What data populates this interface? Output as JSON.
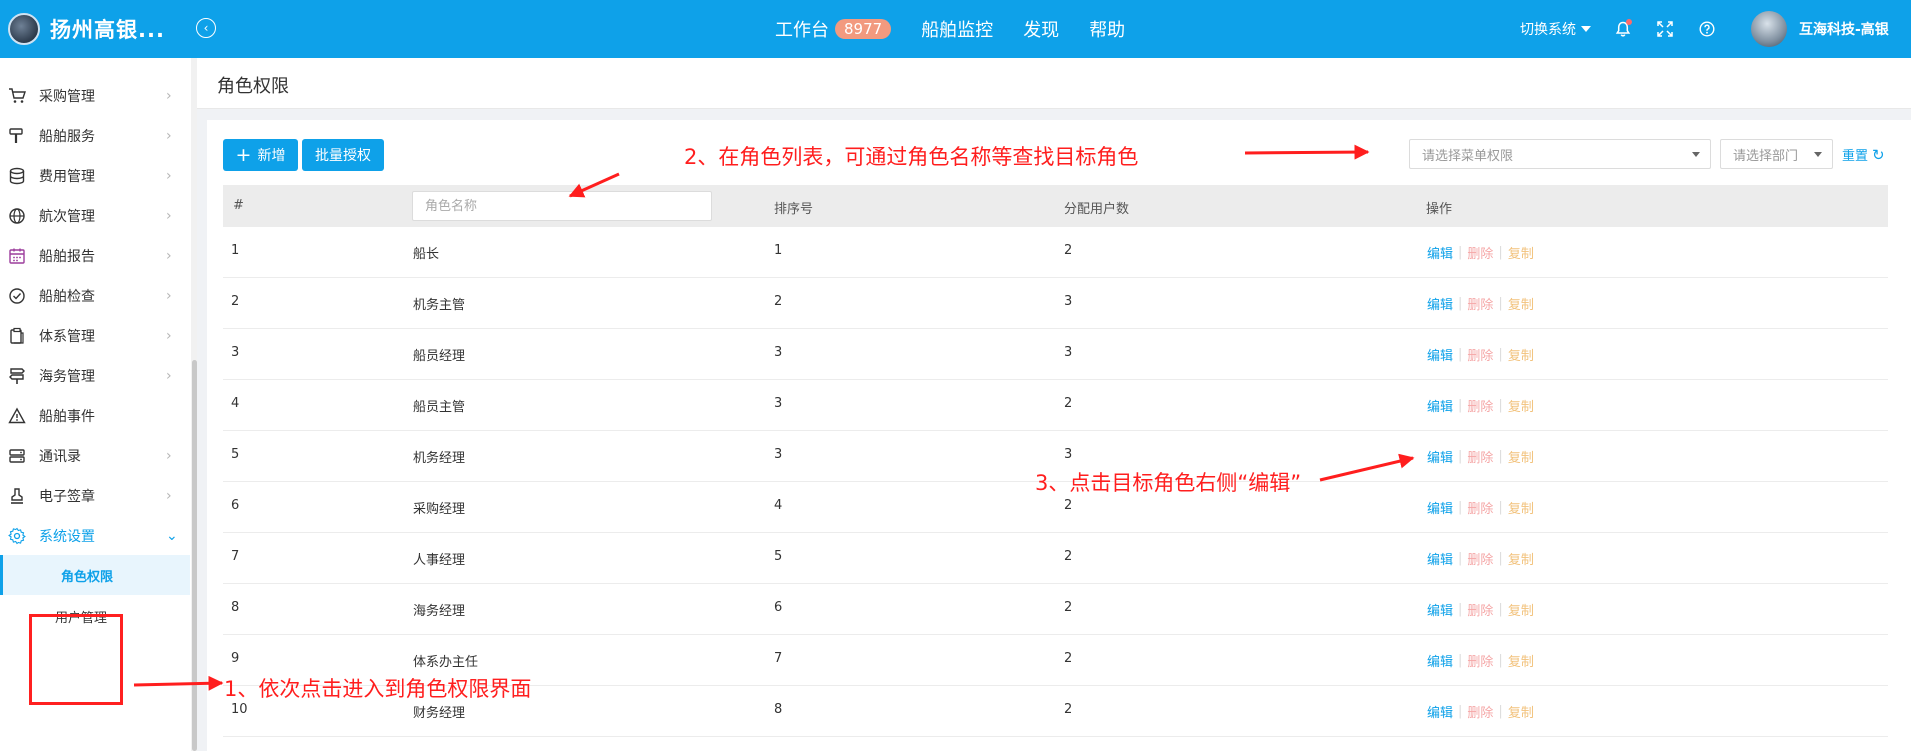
{
  "app": {
    "brand": "扬州高银..."
  },
  "topnav": [
    {
      "label": "工作台",
      "badge": "8977"
    },
    {
      "label": "船舶监控"
    },
    {
      "label": "发现"
    },
    {
      "label": "帮助"
    }
  ],
  "topright": {
    "switch_system": "切换系统",
    "username": "互海科技-高银"
  },
  "sidebar": {
    "items": [
      {
        "label": "采购管理",
        "icon": "cart-icon"
      },
      {
        "label": "船舶服务",
        "icon": "hammer-icon"
      },
      {
        "label": "费用管理",
        "icon": "database-icon"
      },
      {
        "label": "航次管理",
        "icon": "globe-icon"
      },
      {
        "label": "船舶报告",
        "icon": "calendar-icon"
      },
      {
        "label": "船舶检查",
        "icon": "check-circle-icon"
      },
      {
        "label": "体系管理",
        "icon": "clipboard-icon"
      },
      {
        "label": "海务管理",
        "icon": "signpost-icon"
      },
      {
        "label": "船舶事件",
        "icon": "warning-icon"
      },
      {
        "label": "通讯录",
        "icon": "server-icon"
      },
      {
        "label": "电子签章",
        "icon": "stamp-icon"
      },
      {
        "label": "系统设置",
        "icon": "gear-icon"
      }
    ],
    "sub_items": [
      {
        "label": "角色权限"
      },
      {
        "label": "用户管理"
      }
    ]
  },
  "page": {
    "title": "角色权限"
  },
  "toolbar": {
    "add_label": "新增",
    "batch_label": "批量授权",
    "menu_select_placeholder": "请选择菜单权限",
    "dept_select_placeholder": "请选择部门",
    "reset_label": "重置"
  },
  "table": {
    "headers": [
      "#",
      "排序号",
      "分配用户数",
      "操作"
    ],
    "search_placeholder": "角色名称",
    "op_labels": {
      "edit": "编辑",
      "delete": "删除",
      "copy": "复制"
    },
    "rows": [
      {
        "no": "1",
        "name": "船长",
        "order": "1",
        "users": "2"
      },
      {
        "no": "2",
        "name": "机务主管",
        "order": "2",
        "users": "3"
      },
      {
        "no": "3",
        "name": "船员经理",
        "order": "3",
        "users": "3"
      },
      {
        "no": "4",
        "name": "船员主管",
        "order": "3",
        "users": "2"
      },
      {
        "no": "5",
        "name": "机务经理",
        "order": "3",
        "users": "3"
      },
      {
        "no": "6",
        "name": "采购经理",
        "order": "4",
        "users": "2"
      },
      {
        "no": "7",
        "name": "人事经理",
        "order": "5",
        "users": "2"
      },
      {
        "no": "8",
        "name": "海务经理",
        "order": "6",
        "users": "2"
      },
      {
        "no": "9",
        "name": "体系办主任",
        "order": "7",
        "users": "2"
      },
      {
        "no": "10",
        "name": "财务经理",
        "order": "8",
        "users": "2"
      }
    ]
  },
  "annotations": {
    "step1": "1、依次点击进入到角色权限界面",
    "step2": "2、在角色列表，可通过角色名称等查找目标角色",
    "step3": "3、点击目标角色右侧“编辑”"
  },
  "colors": {
    "primary": "#0ea1e9",
    "annotation": "#ff1e1e",
    "delete": "#f5a6a6",
    "copy": "#f2c27c"
  }
}
